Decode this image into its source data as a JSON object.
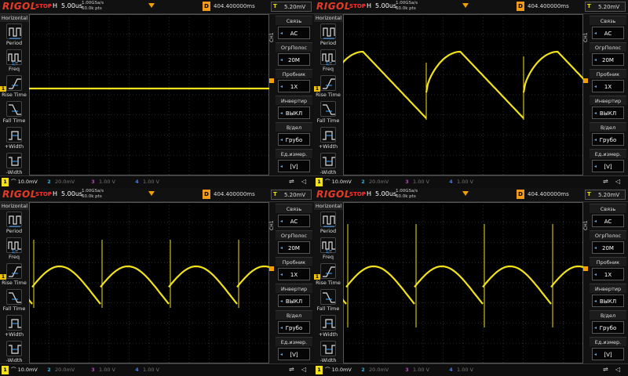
{
  "panels": [
    {
      "brand": "RIGOL",
      "state": "STOP",
      "h": "H",
      "timebase": "5.00us",
      "srate1": "1.00GSa/s",
      "srate2": "60.0k pts",
      "delay_label": "D",
      "delay": "404.400000ms",
      "trig_ch": "T",
      "trig_level": "5.20mV",
      "waveform": "flat"
    },
    {
      "brand": "RIGOL",
      "state": "STOP",
      "h": "H",
      "timebase": "5.00us",
      "srate1": "1.00GSa/s",
      "srate2": "60.0k pts",
      "delay_label": "D",
      "delay": "404.400000ms",
      "trig_ch": "T",
      "trig_level": "5.20mV",
      "waveform": "sawdecay"
    },
    {
      "brand": "RIGOL",
      "state": "STOP",
      "h": "H",
      "timebase": "5.00us",
      "srate1": "1.00GSa/s",
      "srate2": "60.0k pts",
      "delay_label": "D",
      "delay": "404.400000ms",
      "trig_ch": "T",
      "trig_level": "5.20mV",
      "waveform": "arch4"
    },
    {
      "brand": "RIGOL",
      "state": "STOP",
      "h": "H",
      "timebase": "5.00us",
      "srate1": "1.00GSa/s",
      "srate2": "60.0k pts",
      "delay_label": "D",
      "delay": "404.400000ms",
      "trig_ch": "T",
      "trig_level": "5.20mV",
      "waveform": "arch4spike"
    }
  ],
  "left_menu": {
    "title": "Horizontal",
    "items": [
      "Period",
      "Freq",
      "Rise Time",
      "Fall Time",
      "+Width",
      "-Width"
    ]
  },
  "right_menu": {
    "channel_tab": "CH1",
    "items": [
      {
        "label": "Связь",
        "value": "AC"
      },
      {
        "label": "ОгрПолос",
        "value": "20M"
      },
      {
        "label": "Пробник",
        "value": "1X"
      },
      {
        "label": "Инвертир",
        "value": "ВЫКЛ"
      },
      {
        "label": "В/дел",
        "value": "Грубо"
      },
      {
        "label": "Ед.измер.",
        "value": "[V]"
      }
    ]
  },
  "bottom": {
    "ch1": {
      "num": "1",
      "scale": "10.0mV"
    },
    "ch2": {
      "num": "2",
      "scale": "20.0mV"
    },
    "ch3": {
      "num": "3",
      "scale": "1.00 V"
    },
    "ch4": {
      "num": "4",
      "scale": "1.00 V"
    }
  },
  "colors": {
    "ch1": "#f2e21c",
    "ch2": "#2ab5e8",
    "ch3": "#c43bc8",
    "ch4": "#3a7de8",
    "grid": "#3a3a3a",
    "brand": "#e63a2a"
  },
  "icons": {
    "usb": "usb-icon",
    "speaker": "speaker-icon"
  }
}
